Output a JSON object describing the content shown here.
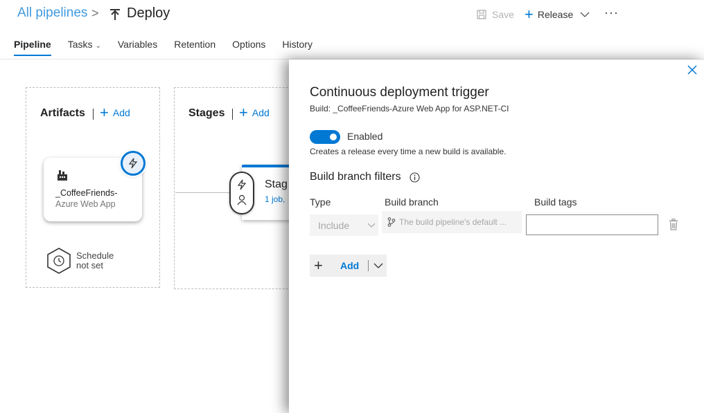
{
  "header": {
    "breadcrumb": "All pipelines",
    "separator": ">",
    "title": "Deploy",
    "save_label": "Save",
    "release_label": "Release",
    "more_label": "···"
  },
  "tabs": [
    {
      "label": "Pipeline",
      "active": true
    },
    {
      "label": "Tasks",
      "has_dropdown": true
    },
    {
      "label": "Variables"
    },
    {
      "label": "Retention"
    },
    {
      "label": "Options"
    },
    {
      "label": "History"
    }
  ],
  "artifacts": {
    "title": "Artifacts",
    "add_label": "Add",
    "artifact_name_line1": "_CoffeeFriends-",
    "artifact_name_line2": "Azure Web App",
    "schedule_line1": "Schedule",
    "schedule_line2": "not set"
  },
  "stages": {
    "title": "Stages",
    "add_label": "Add",
    "stage_name": "Stag",
    "stage_sub": "1 job,"
  },
  "trigger_panel": {
    "title": "Continuous deployment trigger",
    "subtitle": "Build: _CoffeeFriends-Azure Web App for ASP.NET-CI",
    "toggle_label": "Enabled",
    "toggle_on": true,
    "toggle_desc": "Creates a release every time a new build is available.",
    "filters_title": "Build branch filters",
    "col_type": "Type",
    "col_branch": "Build branch",
    "col_tags": "Build tags",
    "type_value": "Include",
    "branch_placeholder": "The build pipeline's default ...",
    "tags_value": "",
    "add_label": "Add"
  },
  "colors": {
    "accent": "#0078d4",
    "disabled": "#b4b4b4"
  },
  "icons": [
    "pipeline-deploy-icon",
    "save-icon",
    "plus-icon",
    "chevron-down-icon",
    "factory-icon",
    "lightning-icon",
    "clock-icon",
    "person-icon",
    "close-icon",
    "info-icon",
    "branch-icon",
    "trash-icon"
  ]
}
